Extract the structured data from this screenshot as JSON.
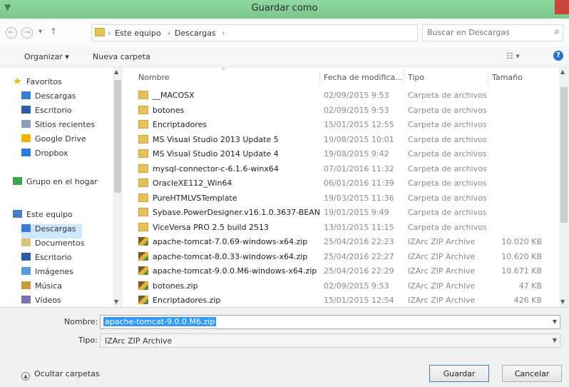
{
  "window": {
    "title": "Guardar como",
    "icon": "app-icon"
  },
  "address": {
    "crumbs": [
      "Este equipo",
      "Descargas"
    ],
    "search_placeholder": "Buscar en Descargas"
  },
  "toolbar": {
    "organize": "Organizar ▾",
    "new_folder": "Nueva carpeta",
    "view": "☷ ▾",
    "help": "?"
  },
  "nav": {
    "items": [
      {
        "label": "Favoritos",
        "icon": "star-icon",
        "color": "#e8b820"
      },
      {
        "label": "Descargas",
        "icon": "downloads-icon",
        "color": "#3a7bd5"
      },
      {
        "label": "Escritorio",
        "icon": "desktop-icon",
        "color": "#2a5fa8"
      },
      {
        "label": "Sitios recientes",
        "icon": "recent-icon",
        "color": "#8aa0b8"
      },
      {
        "label": "Google Drive",
        "icon": "drive-icon",
        "color": "#f0b400"
      },
      {
        "label": "Dropbox",
        "icon": "dropbox-icon",
        "color": "#2b7de0"
      },
      {
        "label": "Grupo en el hogar",
        "icon": "homegroup-icon",
        "color": "#3da34a"
      },
      {
        "label": "Este equipo",
        "icon": "computer-icon",
        "color": "#4a7bc8"
      },
      {
        "label": "Descargas",
        "icon": "downloads-icon",
        "color": "#3a7bd5"
      },
      {
        "label": "Documentos",
        "icon": "documents-icon",
        "color": "#d9c27a"
      },
      {
        "label": "Escritorio",
        "icon": "desktop-icon",
        "color": "#2a5fa8"
      },
      {
        "label": "Imágenes",
        "icon": "pictures-icon",
        "color": "#5b9bd5"
      },
      {
        "label": "Música",
        "icon": "music-icon",
        "color": "#c79a3a"
      },
      {
        "label": "Vídeos",
        "icon": "videos-icon",
        "color": "#7a6fb8"
      }
    ]
  },
  "columns": {
    "name": "Nombre",
    "date": "Fecha de modifica...",
    "type": "Tipo",
    "size": "Tamaño"
  },
  "files": [
    {
      "name": "__MACOSX",
      "date": "02/09/2015 9:53",
      "type": "Carpeta de archivos",
      "size": "",
      "kind": "folder"
    },
    {
      "name": "botones",
      "date": "02/09/2015 9:53",
      "type": "Carpeta de archivos",
      "size": "",
      "kind": "folder"
    },
    {
      "name": "Encriptadores",
      "date": "15/01/2015 12:55",
      "type": "Carpeta de archivos",
      "size": "",
      "kind": "folder"
    },
    {
      "name": "MS Visual Studio 2013 Update 5",
      "date": "19/08/2015 10:01",
      "type": "Carpeta de archivos",
      "size": "",
      "kind": "folder"
    },
    {
      "name": "MS Visual Studio 2014 Update 4",
      "date": "19/08/2015 9:42",
      "type": "Carpeta de archivos",
      "size": "",
      "kind": "folder"
    },
    {
      "name": "mysql-connector-c-6.1.6-winx64",
      "date": "07/01/2016 11:32",
      "type": "Carpeta de archivos",
      "size": "",
      "kind": "folder"
    },
    {
      "name": "OracleXE112_Win64",
      "date": "06/01/2016 11:39",
      "type": "Carpeta de archivos",
      "size": "",
      "kind": "folder"
    },
    {
      "name": "PureHTMLVSTemplate",
      "date": "19/03/2015 11:36",
      "type": "Carpeta de archivos",
      "size": "",
      "kind": "folder"
    },
    {
      "name": "Sybase.PowerDesigner.v16.1.0.3637-BEAN",
      "date": "19/01/2015 9:49",
      "type": "Carpeta de archivos",
      "size": "",
      "kind": "folder"
    },
    {
      "name": "ViceVersa PRO 2.5 build 2513",
      "date": "13/01/2015 11:15",
      "type": "Carpeta de archivos",
      "size": "",
      "kind": "folder"
    },
    {
      "name": "apache-tomcat-7.0.69-windows-x64.zip",
      "date": "25/04/2016 22:23",
      "type": "IZArc ZIP Archive",
      "size": "10.020 KB",
      "kind": "zip"
    },
    {
      "name": "apache-tomcat-8.0.33-windows-x64.zip",
      "date": "25/04/2016 22:27",
      "type": "IZArc ZIP Archive",
      "size": "10.620 KB",
      "kind": "zip"
    },
    {
      "name": "apache-tomcat-9.0.0.M6-windows-x64.zip",
      "date": "25/04/2016 22:29",
      "type": "IZArc ZIP Archive",
      "size": "10.671 KB",
      "kind": "zip"
    },
    {
      "name": "botones.zip",
      "date": "02/09/2015 9:53",
      "type": "IZArc ZIP Archive",
      "size": "47 KB",
      "kind": "zip"
    },
    {
      "name": "Encriptadores.zip",
      "date": "15/01/2015 12:54",
      "type": "IZArc ZIP Archive",
      "size": "426 KB",
      "kind": "zip"
    }
  ],
  "save": {
    "name_label": "Nombre:",
    "name_value": "apache-tomcat-9.0.0.M6.zip",
    "type_label": "Tipo:",
    "type_value": "IZArc ZIP Archive",
    "hide_folders": "Ocultar carpetas",
    "save_button": "Guardar",
    "cancel_button": "Cancelar"
  },
  "colors": {
    "titlebar": "#7fcf93",
    "folder": "#e7c15a",
    "selection": "#3399ff",
    "close": "#c9453a"
  }
}
